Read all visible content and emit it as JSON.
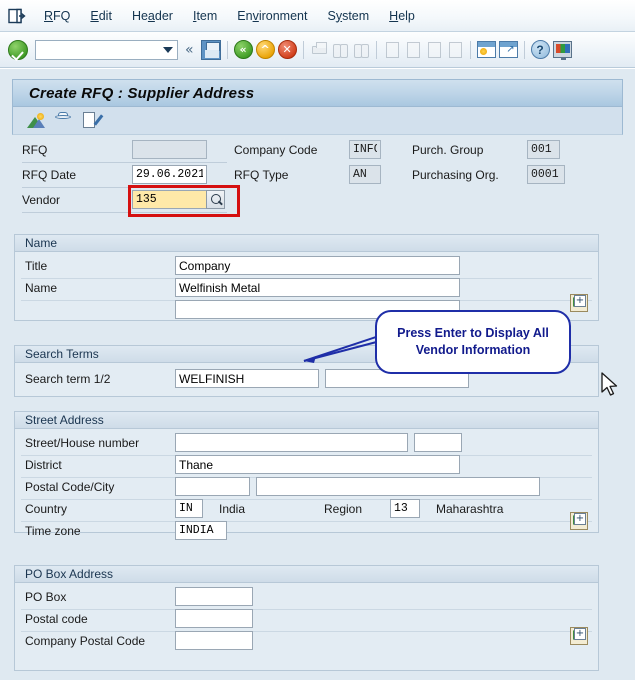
{
  "window": {
    "title": "Create RFQ : Supplier Address"
  },
  "menubar": {
    "system_icon": "system-menu-icon",
    "items": [
      {
        "label": "RFQ",
        "accel": "R"
      },
      {
        "label": "Edit",
        "accel": "E"
      },
      {
        "label": "Header",
        "accel": "a"
      },
      {
        "label": "Item",
        "accel": "I"
      },
      {
        "label": "Environment",
        "accel": "v"
      },
      {
        "label": "System",
        "accel": "y"
      },
      {
        "label": "Help",
        "accel": "H"
      }
    ]
  },
  "toolbar": {
    "enter_icon": "enter-checkmark-icon",
    "command_field_value": "",
    "command_field_placeholder": "",
    "dropdown_icon": "chevron-down-icon",
    "collapse_icon": "double-chevron-left-icon",
    "icons": [
      "save-icon",
      "back-icon",
      "exit-icon",
      "cancel-icon",
      "print-icon",
      "find-icon",
      "find-next-icon",
      "first-page-icon",
      "previous-page-icon",
      "next-page-icon",
      "last-page-icon",
      "create-session-icon",
      "create-shortcut-icon",
      "help-icon",
      "customize-local-layout-icon"
    ]
  },
  "app_toolbar": {
    "icons": [
      "overview-icon",
      "personal-settings-icon",
      "document-edit-icon"
    ]
  },
  "header": {
    "rfq": {
      "label": "RFQ",
      "value": ""
    },
    "rfq_date": {
      "label": "RFQ Date",
      "value": "29.06.2021"
    },
    "vendor": {
      "label": "Vendor",
      "value": "135",
      "search_icon": "search-help-icon"
    },
    "company_code": {
      "label": "Company Code",
      "value": "INFO"
    },
    "rfq_type": {
      "label": "RFQ Type",
      "value": "AN"
    },
    "purch_group": {
      "label": "Purch. Group",
      "value": "001"
    },
    "purchasing_org": {
      "label": "Purchasing Org.",
      "value": "0001"
    }
  },
  "callout": {
    "line1": "Press Enter to Display All",
    "line2": "Vendor Information",
    "border_color": "#1f2ea8",
    "text_color": "#111a8c"
  },
  "sections": {
    "name": {
      "title": "Name",
      "title_field": {
        "label": "Title",
        "value": "Company"
      },
      "name_field": {
        "label": "Name",
        "value": "Welfinish Metal"
      },
      "name2_field": {
        "label": "",
        "value": ""
      },
      "expand_icon": "expand-details-icon"
    },
    "search_terms": {
      "title": "Search Terms",
      "search_term": {
        "label": "Search term 1/2",
        "value1": "WELFINISH",
        "value2": ""
      }
    },
    "street_address": {
      "title": "Street Address",
      "street": {
        "label": "Street/House number",
        "value1": "",
        "value2": ""
      },
      "district": {
        "label": "District",
        "value": "Thane"
      },
      "postal_city": {
        "label": "Postal Code/City",
        "value1": "",
        "value2": ""
      },
      "country": {
        "label": "Country",
        "value": "IN",
        "text": "India"
      },
      "region": {
        "label": "Region",
        "value": "13",
        "text": "Maharashtra"
      },
      "time_zone": {
        "label": "Time zone",
        "value": "INDIA"
      },
      "expand_icon": "expand-details-icon"
    },
    "po_box_address": {
      "title": "PO Box Address",
      "po_box": {
        "label": "PO Box",
        "value": ""
      },
      "postal_code": {
        "label": "Postal code",
        "value": ""
      },
      "company_postal_code": {
        "label": "Company Postal Code",
        "value": ""
      },
      "expand_icon": "expand-details-icon"
    }
  },
  "colors": {
    "required_field_bg": "#ffe9a8",
    "highlight_box": "#d51010",
    "panel_bg": "#dfe9f1",
    "group_bg": "#e3ecf3"
  },
  "cursor": {
    "name": "mouse-pointer"
  }
}
